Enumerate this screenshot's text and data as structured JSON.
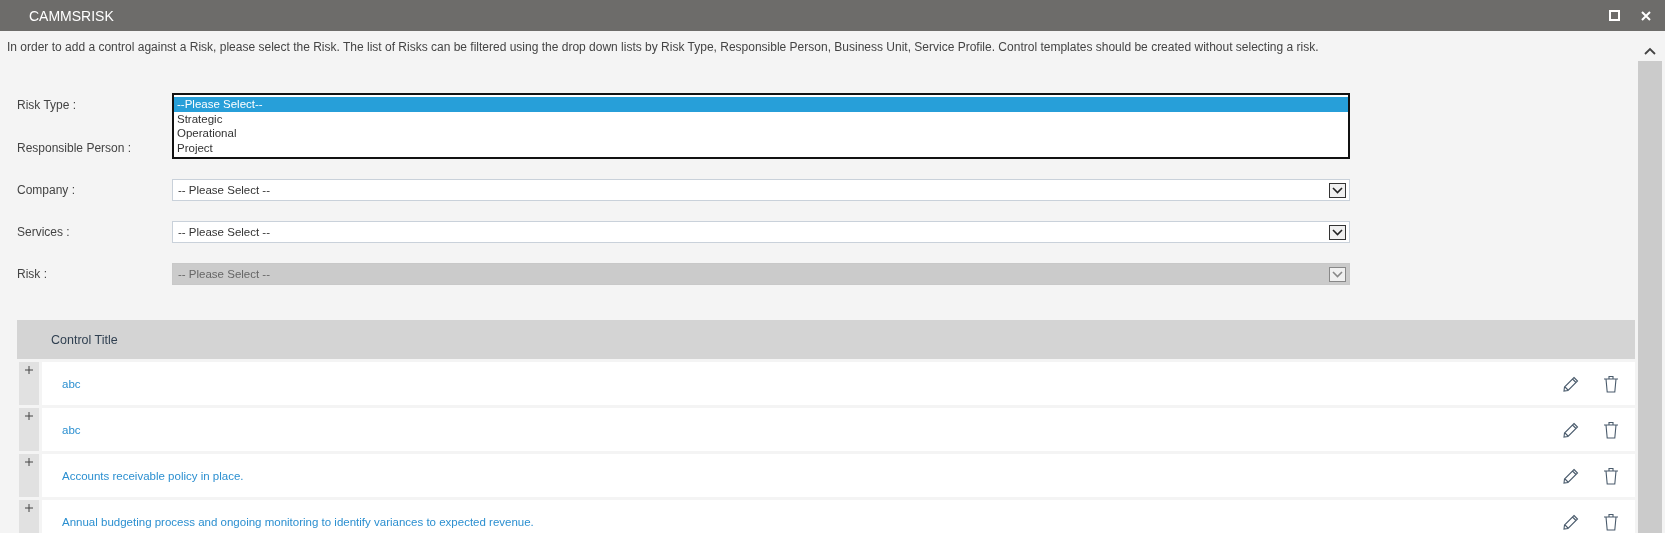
{
  "window": {
    "title": "CAMMSRISK"
  },
  "intro": "In order to add a control against a Risk, please select the Risk. The list of Risks can be filtered using the drop down lists by Risk Type, Responsible Person, Business Unit, Service Profile. Control templates should be created without selecting a risk.",
  "risk_type": {
    "label": "Risk Type :",
    "options": [
      {
        "label": "--Please Select--",
        "selected": true
      },
      {
        "label": "Strategic",
        "selected": false
      },
      {
        "label": "Operational",
        "selected": false
      },
      {
        "label": "Project",
        "selected": false
      }
    ]
  },
  "responsible_person": {
    "label": "Responsible Person :"
  },
  "selects": [
    {
      "label": "Company :",
      "value": "-- Please Select --",
      "disabled": false
    },
    {
      "label": "Services :",
      "value": "-- Please Select --",
      "disabled": false
    },
    {
      "label": "Risk :",
      "value": "-- Please Select --",
      "disabled": true
    }
  ],
  "table": {
    "columns": [
      "Control Title"
    ],
    "rows": [
      {
        "title": "abc"
      },
      {
        "title": "abc"
      },
      {
        "title": "Accounts receivable policy in place."
      },
      {
        "title": "Annual budgeting process and ongoing monitoring to identify variances to expected revenue."
      }
    ]
  }
}
